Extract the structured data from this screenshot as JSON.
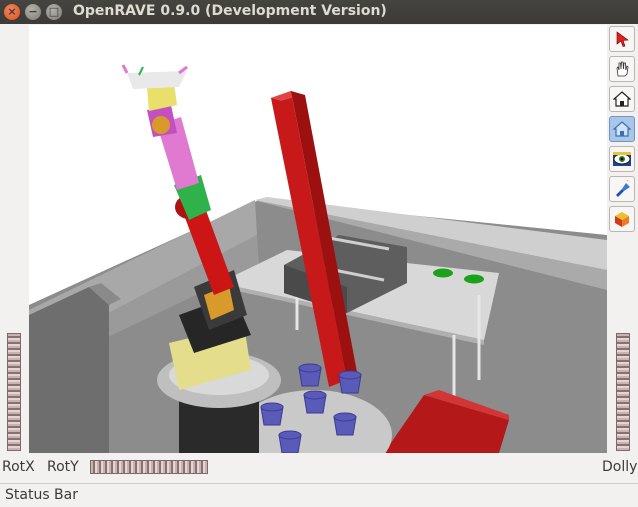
{
  "window": {
    "title": "OpenRAVE 0.9.0 (Development Version)",
    "controls": [
      "close-icon",
      "minimize-icon",
      "maximize-icon"
    ]
  },
  "toolbar": {
    "tools": [
      {
        "name": "select-arrow-icon",
        "active": false
      },
      {
        "name": "pan-hand-icon",
        "active": false
      },
      {
        "name": "home-icon",
        "active": false
      },
      {
        "name": "set-home-icon",
        "active": true
      },
      {
        "name": "view-all-eye-icon",
        "active": false
      },
      {
        "name": "seek-flashlight-icon",
        "active": false
      },
      {
        "name": "perspective-cube-icon",
        "active": false
      }
    ]
  },
  "thumbwheels": {
    "rot_x_label": "RotX",
    "rot_y_label": "RotY",
    "dolly_label": "Dolly"
  },
  "status_bar": {
    "text": "Status Bar"
  },
  "colors": {
    "titlebar": "#3c3b37",
    "close_button": "#e3531c",
    "floor": "#8a8a8a",
    "red_bar": "#c8191a",
    "cups": "#5a5ab8",
    "table_top": "#dcdcdc"
  }
}
